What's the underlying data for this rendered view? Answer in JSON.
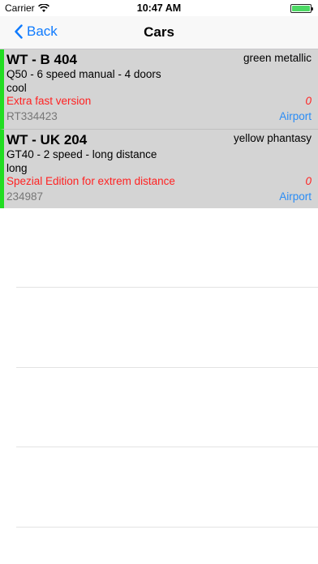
{
  "status": {
    "carrier": "Carrier",
    "time": "10:47 AM"
  },
  "nav": {
    "back_label": "Back",
    "title": "Cars"
  },
  "cars": [
    {
      "plate": "WT - B 404",
      "color": "green metallic",
      "model_line1": "Q50 - 6 speed manual - 4 doors",
      "model_line2": "cool",
      "note": "Extra fast version",
      "count": "0",
      "code": "RT334423",
      "location": "Airport"
    },
    {
      "plate": "WT - UK 204",
      "color": "yellow phantasy",
      "model_line1": "GT40 - 2 speed - long distance",
      "model_line2": "long",
      "note": "Spezial Edition for extrem distance",
      "count": "0",
      "code": "234987",
      "location": "Airport"
    }
  ],
  "colors": {
    "accent": "#0e7afe",
    "row_background": "#d4d4d4",
    "status_bar_green": "#22dd22",
    "warning_red": "#ff2222",
    "link_blue": "#2a8cf5"
  }
}
